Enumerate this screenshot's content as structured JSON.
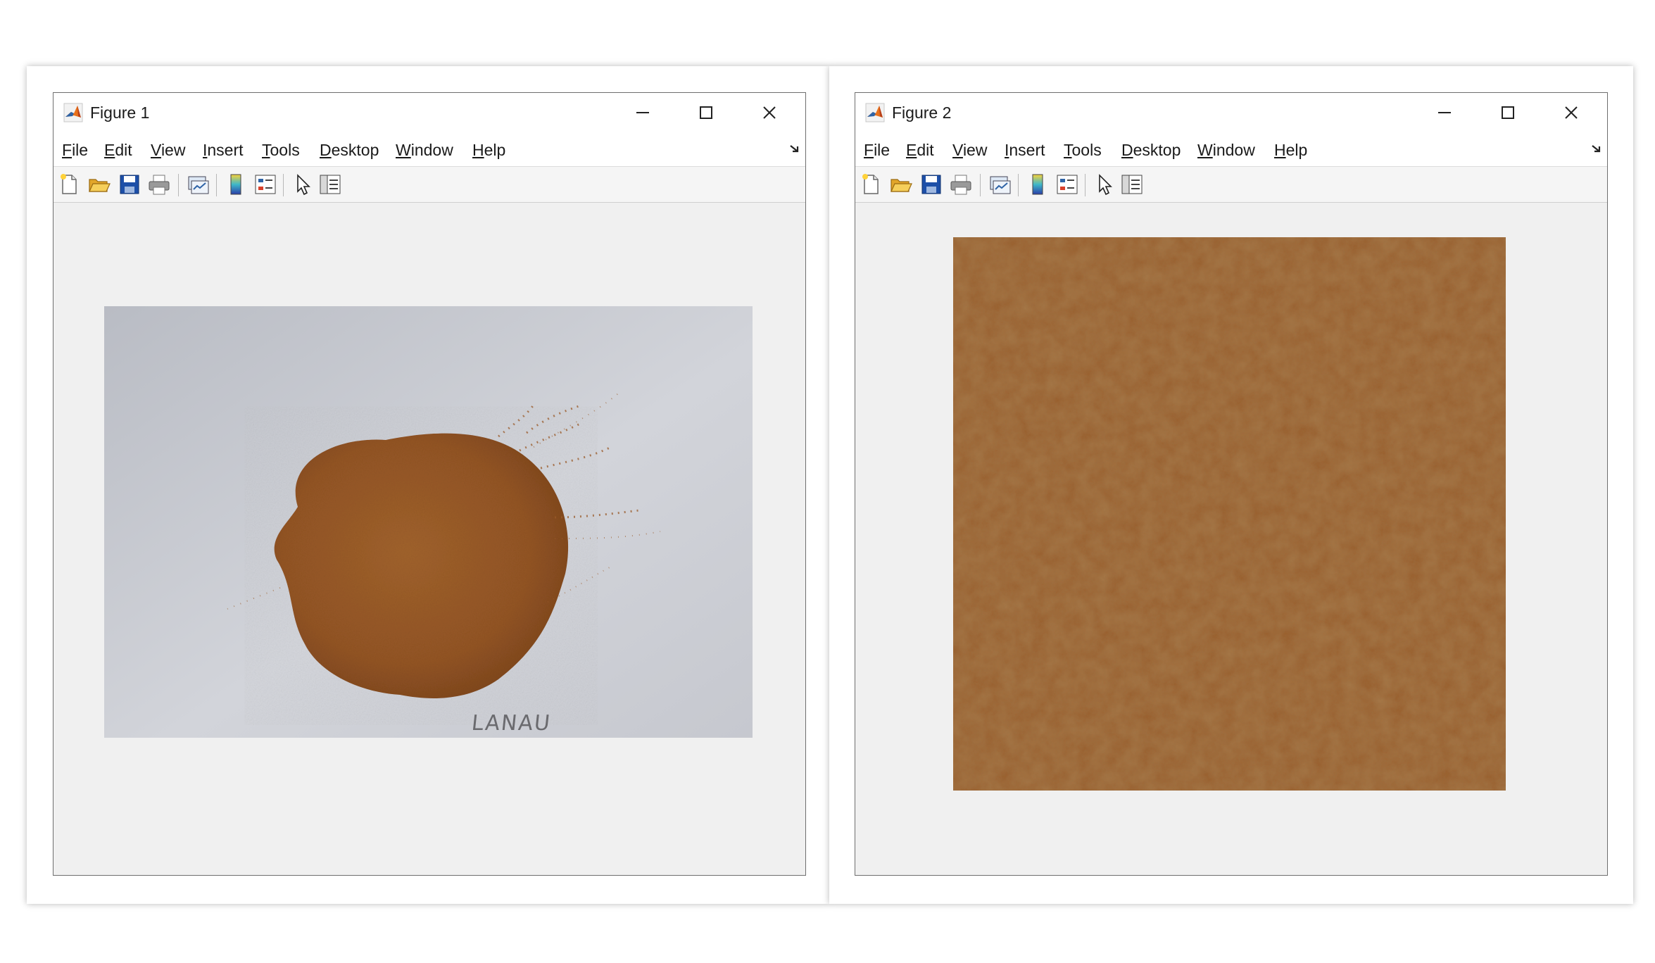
{
  "figure1": {
    "title": "Figure 1",
    "image": {
      "subject": "powder-pile-on-white-card",
      "signature": "LANAU",
      "powder_color": "#9a5a28",
      "background_color": "#c9ccd2"
    }
  },
  "figure2": {
    "title": "Figure 2",
    "image": {
      "subject": "powder-closeup-crop",
      "powder_color": "#9a5e2c"
    }
  },
  "menu": [
    {
      "mnemonic": "F",
      "rest": "ile"
    },
    {
      "mnemonic": "E",
      "rest": "dit"
    },
    {
      "mnemonic": "V",
      "rest": "iew"
    },
    {
      "mnemonic": "I",
      "rest": "nsert"
    },
    {
      "mnemonic": "T",
      "rest": "ools"
    },
    {
      "mnemonic": "D",
      "rest": "esktop"
    },
    {
      "mnemonic": "W",
      "rest": "indow"
    },
    {
      "mnemonic": "H",
      "rest": "elp"
    }
  ],
  "toolbar_icons": [
    "new-figure-icon",
    "open-file-icon",
    "save-icon",
    "print-icon",
    "link-plot-icon",
    "insert-colorbar-icon",
    "insert-legend-icon",
    "edit-plot-icon",
    "open-property-inspector-icon"
  ],
  "window_controls": [
    "minimize-icon",
    "maximize-icon",
    "close-icon"
  ],
  "colors": {
    "window_background": "#f0f0f0",
    "border": "#6e6e6e",
    "accent": "#e8701a"
  }
}
